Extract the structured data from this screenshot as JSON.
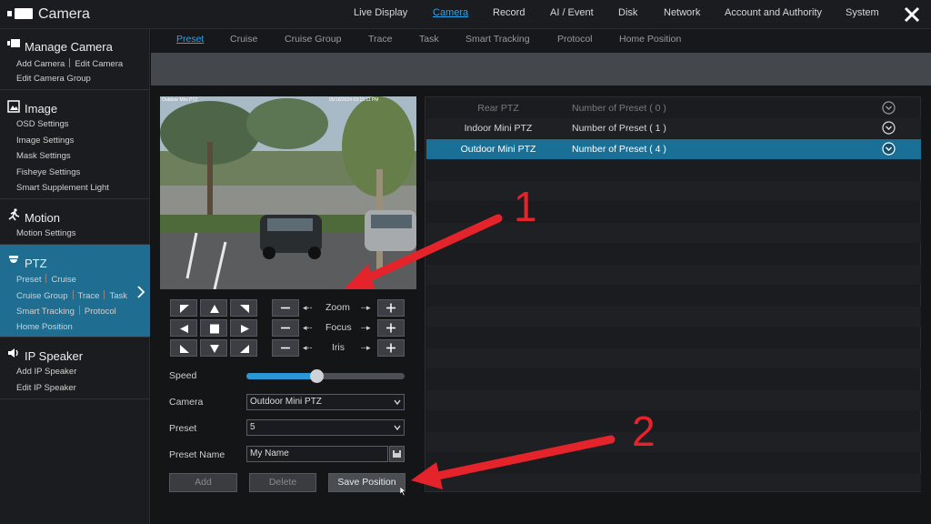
{
  "app": {
    "title": "Camera"
  },
  "nav": [
    {
      "label": "Live Display",
      "active": false
    },
    {
      "label": "Camera",
      "active": true
    },
    {
      "label": "Record",
      "active": false
    },
    {
      "label": "AI / Event",
      "active": false
    },
    {
      "label": "Disk",
      "active": false
    },
    {
      "label": "Network",
      "active": false
    },
    {
      "label": "Account and Authority",
      "active": false
    },
    {
      "label": "System",
      "active": false
    }
  ],
  "sidebar": {
    "sections": [
      {
        "title": "Manage Camera",
        "icon": "camera-icon",
        "lines": [
          [
            "Add Camera",
            "Edit Camera"
          ],
          [
            "Edit Camera Group"
          ]
        ]
      },
      {
        "title": "Image",
        "icon": "image-icon",
        "lines": [
          [
            "OSD Settings"
          ],
          [
            "Image Settings"
          ],
          [
            "Mask Settings"
          ],
          [
            "Fisheye Settings"
          ],
          [
            "Smart Supplement Light"
          ]
        ]
      },
      {
        "title": "Motion",
        "icon": "running-person-icon",
        "lines": [
          [
            "Motion Settings"
          ]
        ]
      },
      {
        "title": "PTZ",
        "icon": "ptz-dome-icon",
        "active": true,
        "lines": [
          [
            "Preset",
            "Cruise"
          ],
          [
            "Cruise Group",
            "Trace",
            "Task"
          ],
          [
            "Smart Tracking",
            "Protocol"
          ],
          [
            "Home Position"
          ]
        ]
      },
      {
        "title": "IP Speaker",
        "icon": "speaker-icon",
        "lines": [
          [
            "Add IP Speaker"
          ],
          [
            "Edit IP Speaker"
          ]
        ]
      }
    ]
  },
  "tabs": [
    {
      "label": "Preset",
      "active": true
    },
    {
      "label": "Cruise"
    },
    {
      "label": "Cruise Group"
    },
    {
      "label": "Trace"
    },
    {
      "label": "Task"
    },
    {
      "label": "Smart Tracking"
    },
    {
      "label": "Protocol"
    },
    {
      "label": "Home Position"
    }
  ],
  "video": {
    "camera_label": "Outdoor Mini PTZ",
    "timestamp": "05/18/2024 03:15:11 PM"
  },
  "controls": {
    "zoom_label": "Zoom",
    "focus_label": "Focus",
    "iris_label": "Iris",
    "speed_label": "Speed",
    "speed_value": 0.44,
    "camera_label": "Camera",
    "camera_value": "Outdoor Mini PTZ",
    "preset_label": "Preset",
    "preset_value": "5",
    "preset_name_label": "Preset Name",
    "preset_name_value": "My Name",
    "add_label": "Add",
    "delete_label": "Delete",
    "save_label": "Save Position"
  },
  "cameras": [
    {
      "name": "Rear PTZ",
      "count": "Number of Preset ( 0 )",
      "state": "dim"
    },
    {
      "name": "Indoor Mini PTZ",
      "count": "Number of Preset ( 1 )",
      "state": "normal"
    },
    {
      "name": "Outdoor Mini PTZ",
      "count": "Number of Preset ( 4 )",
      "state": "selected"
    }
  ],
  "annotations": {
    "one": "1",
    "two": "2",
    "color": "#e5232a"
  },
  "colors": {
    "accent": "#2ea3e6",
    "selected_row": "#1a6f96",
    "active_sidebar": "#1f6e92"
  }
}
